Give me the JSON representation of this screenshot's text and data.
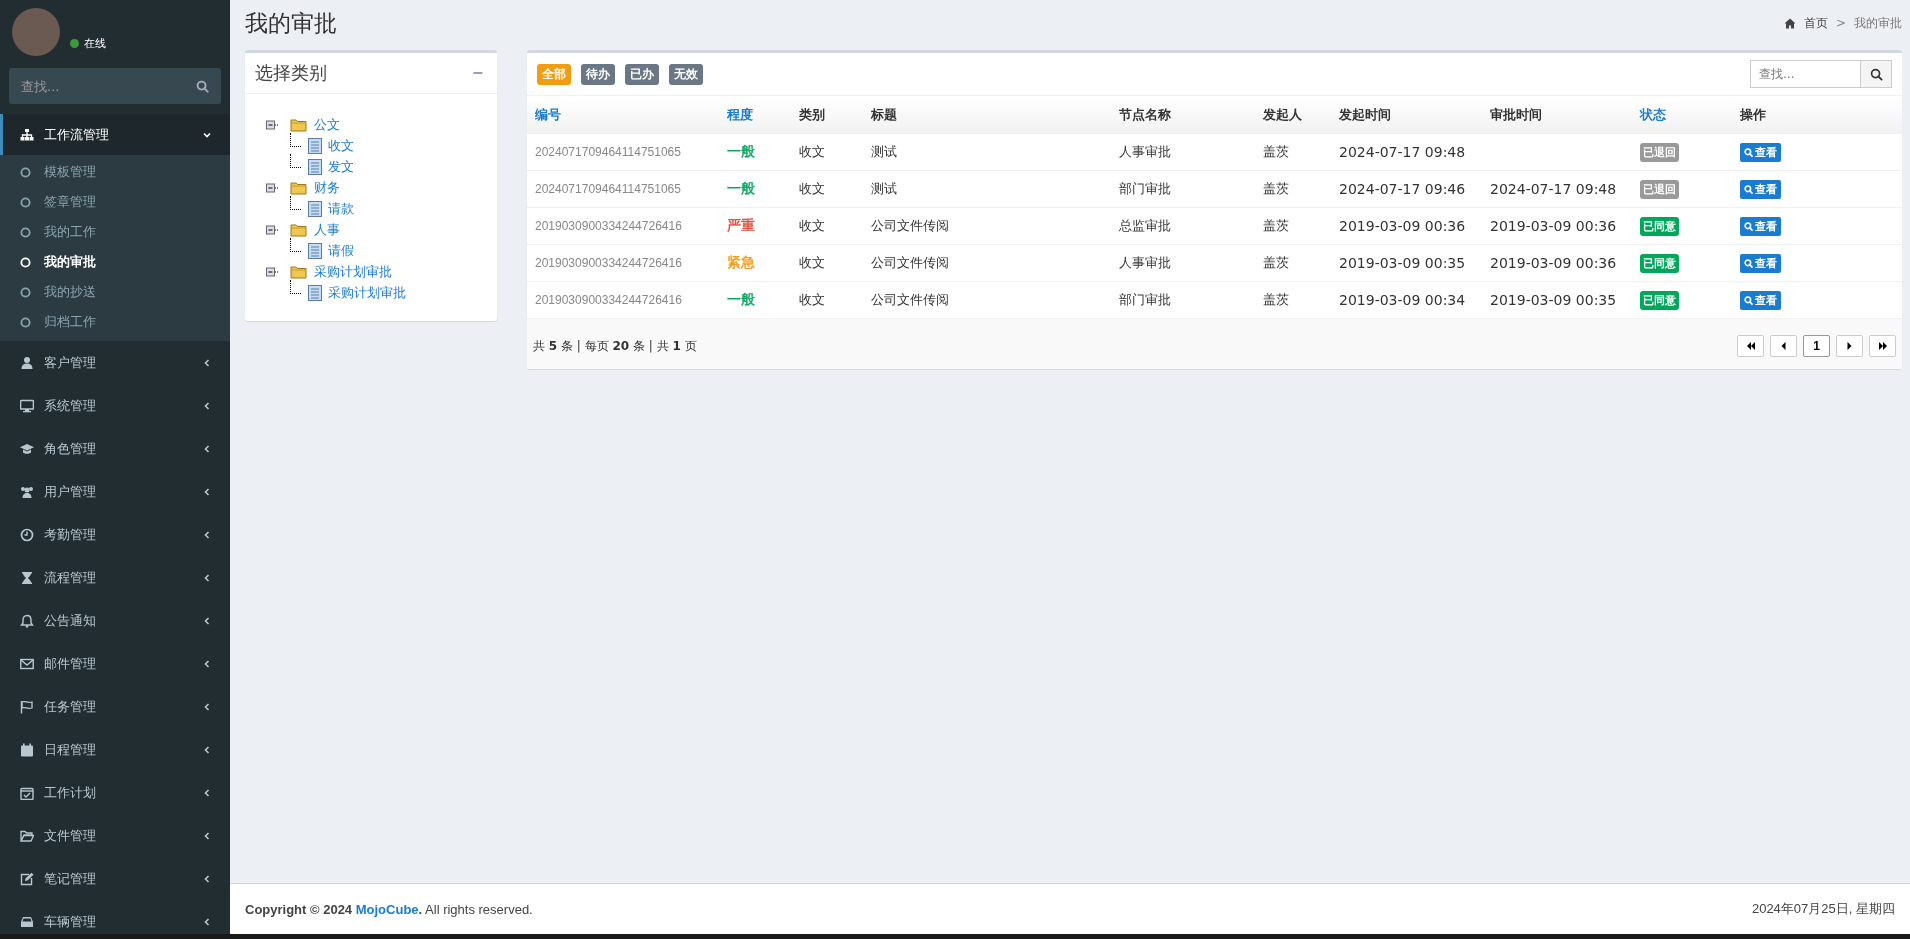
{
  "user": {
    "status": "在线",
    "online": true
  },
  "sidebar_search": {
    "placeholder": "查找..."
  },
  "sidebar": {
    "items": [
      {
        "label": "工作流管理",
        "expanded": true,
        "children": [
          {
            "label": "模板管理",
            "selected": false
          },
          {
            "label": "签章管理",
            "selected": false
          },
          {
            "label": "我的工作",
            "selected": false
          },
          {
            "label": "我的审批",
            "selected": true
          },
          {
            "label": "我的抄送",
            "selected": false
          },
          {
            "label": "归档工作",
            "selected": false
          }
        ]
      },
      {
        "label": "客户管理",
        "expanded": false
      },
      {
        "label": "系统管理",
        "expanded": false
      },
      {
        "label": "角色管理",
        "expanded": false
      },
      {
        "label": "用户管理",
        "expanded": false
      },
      {
        "label": "考勤管理",
        "expanded": false
      },
      {
        "label": "流程管理",
        "expanded": false
      },
      {
        "label": "公告通知",
        "expanded": false
      },
      {
        "label": "邮件管理",
        "expanded": false
      },
      {
        "label": "任务管理",
        "expanded": false
      },
      {
        "label": "日程管理",
        "expanded": false
      },
      {
        "label": "工作计划",
        "expanded": false
      },
      {
        "label": "文件管理",
        "expanded": false
      },
      {
        "label": "笔记管理",
        "expanded": false
      },
      {
        "label": "车辆管理",
        "expanded": false
      }
    ]
  },
  "page_title": "我的审批",
  "breadcrumb": [
    "首页",
    "我的审批"
  ],
  "breadcrumb_separator": ">",
  "category_panel": {
    "title": "选择类别",
    "collapse_label": "−",
    "tree": [
      {
        "label": "公文",
        "expanded": true,
        "children": [
          {
            "label": "收文"
          },
          {
            "label": "发文"
          }
        ]
      },
      {
        "label": "财务",
        "expanded": true,
        "children": [
          {
            "label": "请款"
          }
        ]
      },
      {
        "label": "人事",
        "expanded": true,
        "children": [
          {
            "label": "请假"
          }
        ]
      },
      {
        "label": "采购计划审批",
        "expanded": true,
        "children": [
          {
            "label": "采购计划审批"
          }
        ]
      }
    ]
  },
  "filter_tabs": [
    {
      "label": "全部",
      "selected": true
    },
    {
      "label": "待办",
      "selected": false
    },
    {
      "label": "已办",
      "selected": false
    },
    {
      "label": "无效",
      "selected": false
    }
  ],
  "table_search": {
    "placeholder": "查找..."
  },
  "table": {
    "columns": [
      {
        "label": "编号",
        "sortable": true
      },
      {
        "label": "程度",
        "sortable": true
      },
      {
        "label": "类别",
        "sortable": false
      },
      {
        "label": "标题",
        "sortable": false
      },
      {
        "label": "节点名称",
        "sortable": false
      },
      {
        "label": "发起人",
        "sortable": false
      },
      {
        "label": "发起时间",
        "sortable": false
      },
      {
        "label": "审批时间",
        "sortable": false
      },
      {
        "label": "状态",
        "sortable": true
      },
      {
        "label": "操作",
        "sortable": false
      }
    ],
    "rows": [
      {
        "id": "2024071709464114751065",
        "priority": {
          "text": "一般",
          "color": "#00a65a"
        },
        "category": "收文",
        "title": "测试",
        "node": "人事审批",
        "initiator": "盖茨",
        "start_time": "2024-07-17 09:48",
        "approve_time": "",
        "status": {
          "text": "已退回",
          "kind": "returned"
        },
        "action": "查看"
      },
      {
        "id": "2024071709464114751065",
        "priority": {
          "text": "一般",
          "color": "#00a65a"
        },
        "category": "收文",
        "title": "测试",
        "node": "部门审批",
        "initiator": "盖茨",
        "start_time": "2024-07-17 09:46",
        "approve_time": "2024-07-17 09:48",
        "status": {
          "text": "已退回",
          "kind": "returned"
        },
        "action": "查看"
      },
      {
        "id": "2019030900334244726416",
        "priority": {
          "text": "严重",
          "color": "#dd4b39"
        },
        "category": "收文",
        "title": "公司文件传阅",
        "node": "总监审批",
        "initiator": "盖茨",
        "start_time": "2019-03-09 00:36",
        "approve_time": "2019-03-09 00:36",
        "status": {
          "text": "已同意",
          "kind": "agreed"
        },
        "action": "查看"
      },
      {
        "id": "2019030900334244726416",
        "priority": {
          "text": "紧急",
          "color": "#f39c12"
        },
        "category": "收文",
        "title": "公司文件传阅",
        "node": "人事审批",
        "initiator": "盖茨",
        "start_time": "2019-03-09 00:35",
        "approve_time": "2019-03-09 00:36",
        "status": {
          "text": "已同意",
          "kind": "agreed"
        },
        "action": "查看"
      },
      {
        "id": "2019030900334244726416",
        "priority": {
          "text": "一般",
          "color": "#00a65a"
        },
        "category": "收文",
        "title": "公司文件传阅",
        "node": "部门审批",
        "initiator": "盖茨",
        "start_time": "2019-03-09 00:34",
        "approve_time": "2019-03-09 00:35",
        "status": {
          "text": "已同意",
          "kind": "agreed"
        },
        "action": "查看"
      }
    ]
  },
  "pagination": {
    "summary": "共 **5** 条 | 每页 **20** 条 | 共 **1** 页",
    "pages": [
      {
        "label": "1",
        "selected": true
      }
    ]
  },
  "footer": {
    "copyright": "Copyright © 2024",
    "link": "MojoCube",
    "suffix": "**.** All rights reserved.",
    "date": "2024年07月25日, 星期四"
  }
}
